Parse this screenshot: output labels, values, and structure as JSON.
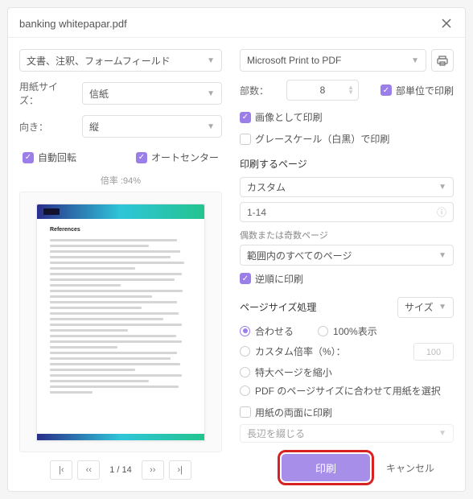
{
  "window": {
    "title": "banking whitepapar.pdf"
  },
  "left": {
    "dropdown": "文書、注釈、フォームフィールド",
    "paperSize": {
      "label": "用紙サイズ：",
      "value": "信紙"
    },
    "orientation": {
      "label": "向き：",
      "value": "縦"
    },
    "autoRotate": "自動回転",
    "autoCenter": "オートセンター",
    "zoom": "倍率 :94%",
    "previewHeading": "References"
  },
  "pager": {
    "first": "|‹",
    "prev": "‹‹",
    "pageDisplay": "1 / 14",
    "next": "››",
    "last": "›|"
  },
  "right": {
    "printer": "Microsoft Print to PDF",
    "copiesLabel": "部数：",
    "copiesValue": "8",
    "collate": "部単位で印刷",
    "asImage": "画像として印刷",
    "grayscale": "グレースケール（白黒）で印刷",
    "pagesHeading": "印刷するページ",
    "rangeMode": "カスタム",
    "rangeValue": "1-14",
    "oddEvenLabel": "偶数または奇数ページ",
    "oddEvenValue": "範囲内のすべてのページ",
    "reverse": "逆順に印刷",
    "sizeHeading": "ページサイズ処理",
    "sizeTab": "サイズ",
    "fit": "合わせる",
    "hundred": "100%表示",
    "customScale": "カスタム倍率（%）：",
    "customScaleValue": "100",
    "shrink": "特大ページを縮小",
    "choosePaper": "PDF のページサイズに合わせて用紙を選択",
    "duplexLabel": "用紙の両面に印刷",
    "duplexValue": "長辺を綴じる",
    "printBtn": "印刷",
    "cancelBtn": "キャンセル"
  }
}
